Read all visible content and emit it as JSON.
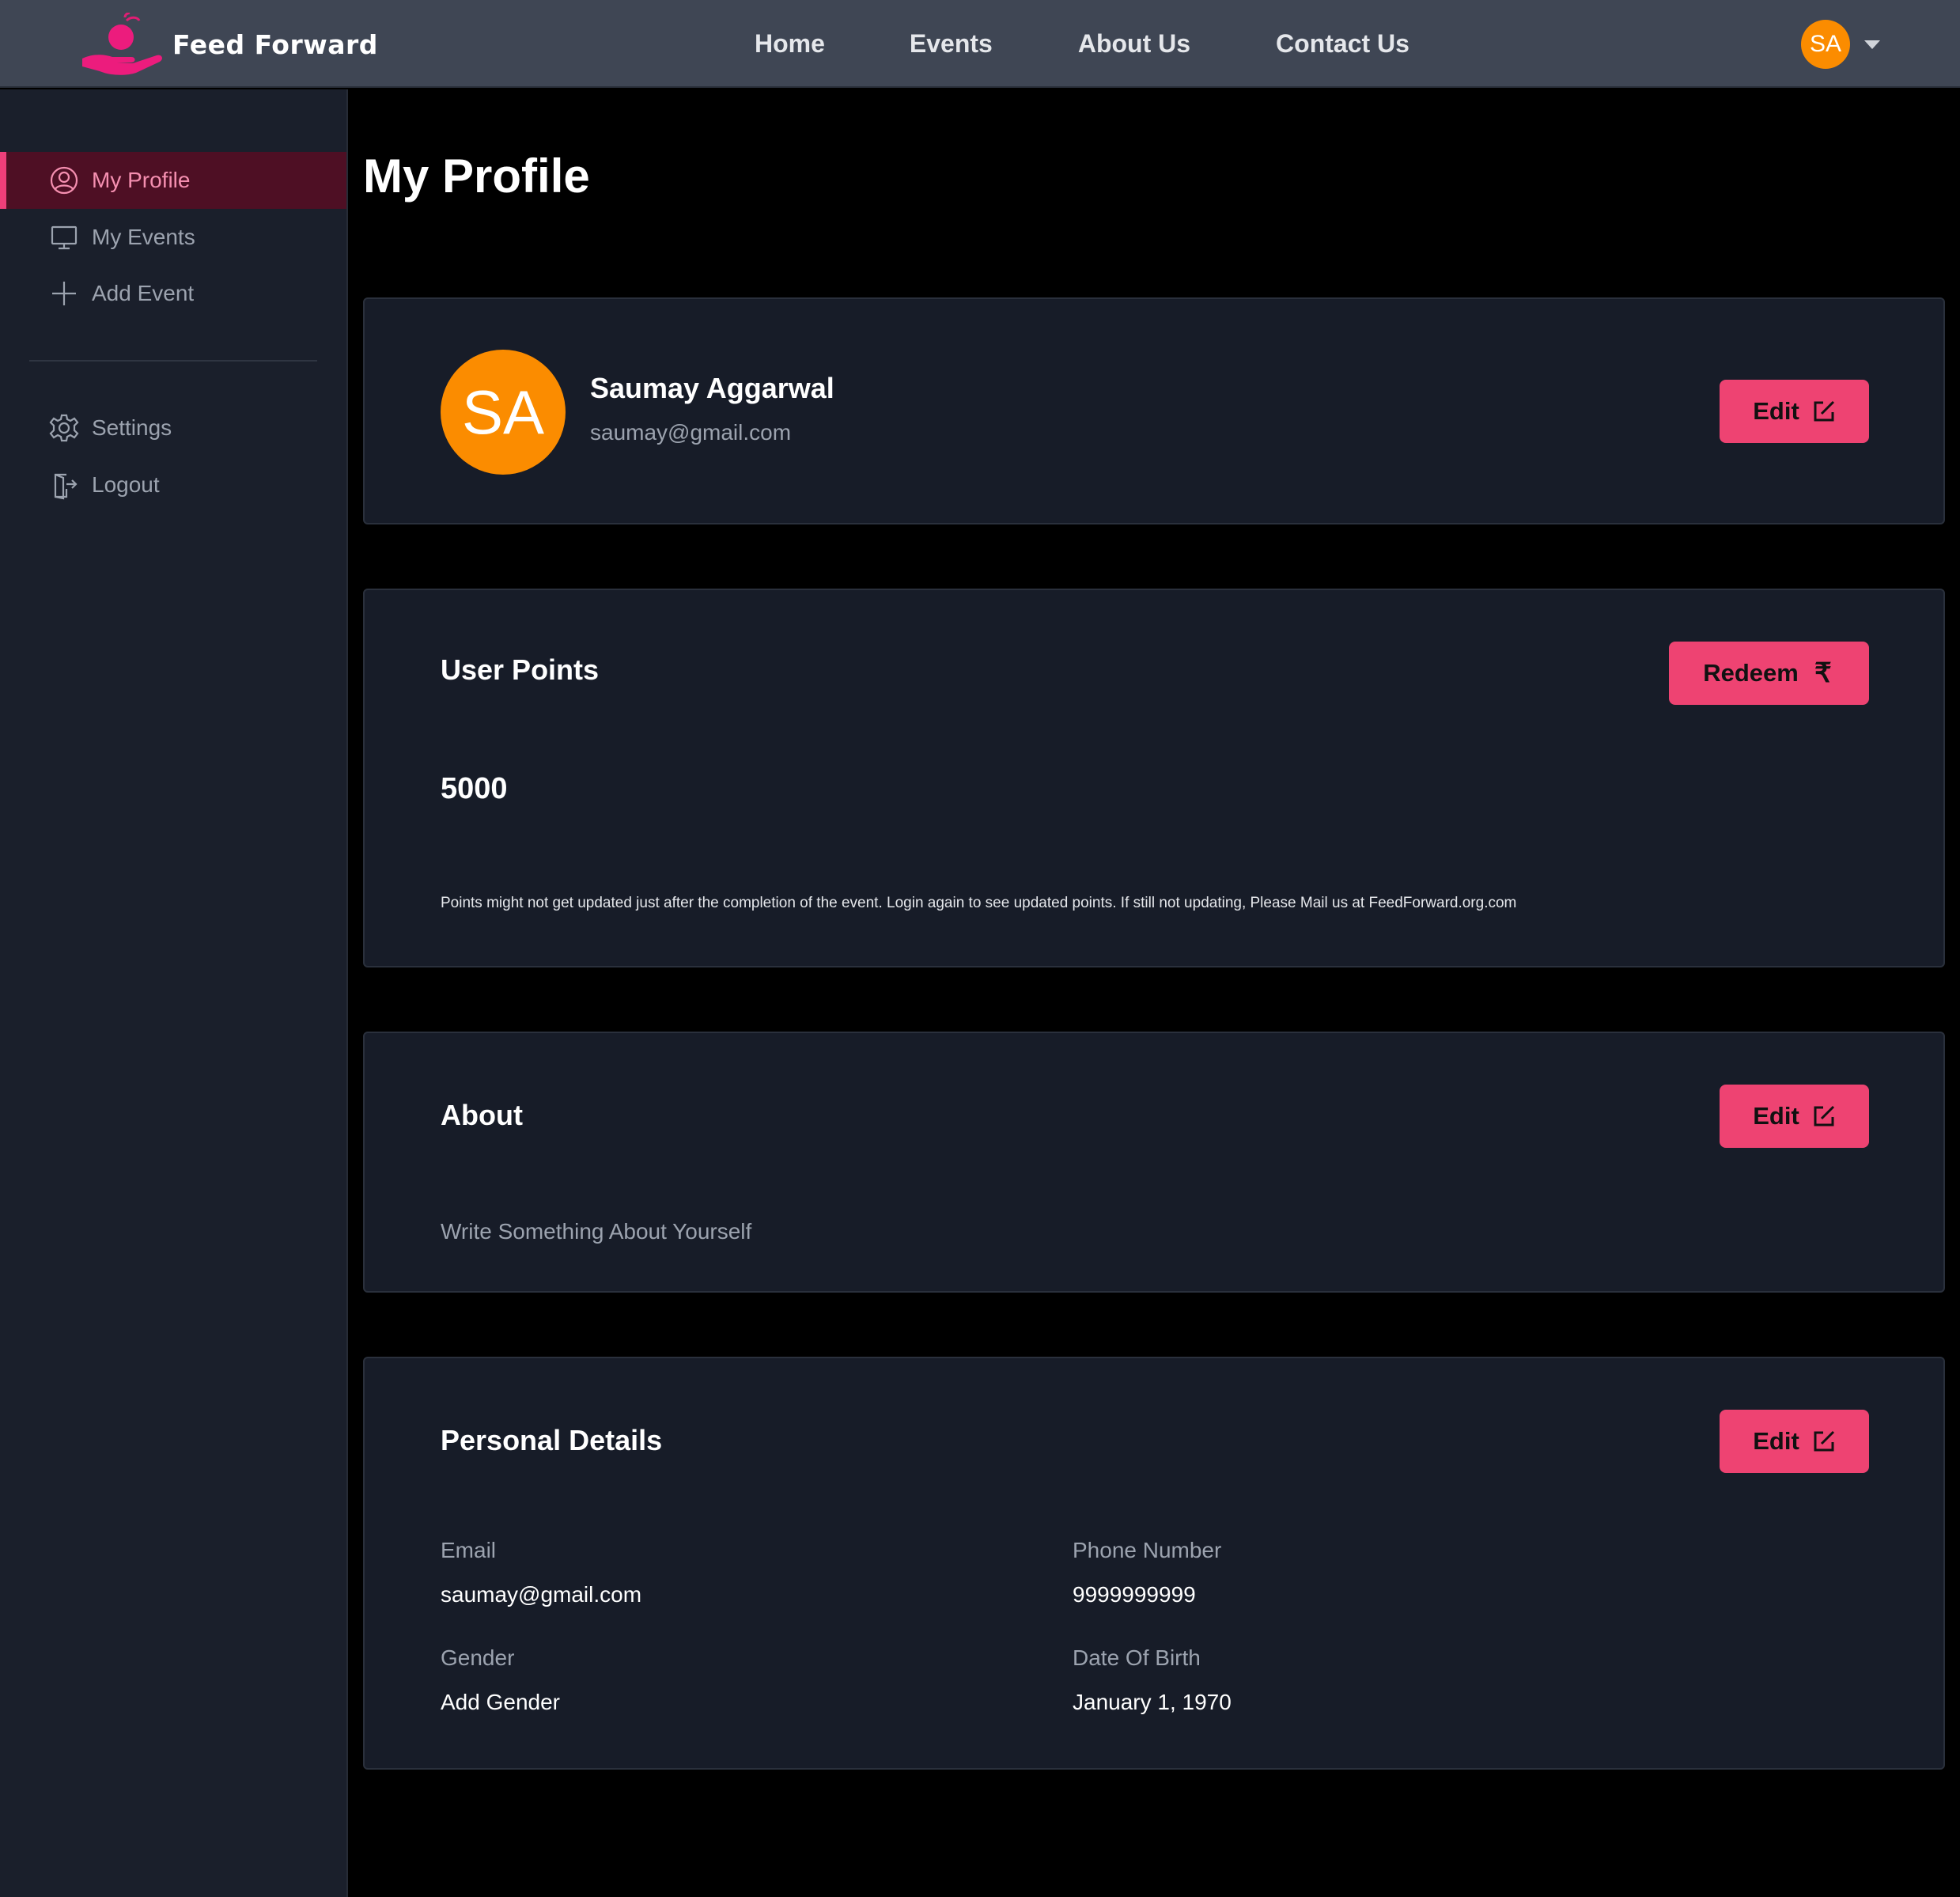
{
  "nav": {
    "brand": "Feed Forward",
    "links": [
      "Home",
      "Events",
      "About Us",
      "Contact Us"
    ],
    "user_initials": "SA"
  },
  "sidebar": {
    "items": [
      {
        "label": "My Profile",
        "icon": "user-circle-icon",
        "active": true
      },
      {
        "label": "My Events",
        "icon": "monitor-icon",
        "active": false
      },
      {
        "label": "Add Event",
        "icon": "plus-icon",
        "active": false
      },
      {
        "label": "Settings",
        "icon": "gear-icon",
        "active": false
      },
      {
        "label": "Logout",
        "icon": "logout-icon",
        "active": false
      }
    ]
  },
  "main": {
    "title": "My Profile",
    "profile": {
      "initials": "SA",
      "name": "Saumay Aggarwal",
      "email": "saumay@gmail.com",
      "edit_label": "Edit"
    },
    "points": {
      "title": "User Points",
      "redeem_label": "Redeem",
      "value": "5000",
      "note": "Points might not get updated just after the completion of the event. Login again to see updated points. If still not updating, Please Mail us at FeedForward.org.com"
    },
    "about": {
      "title": "About",
      "edit_label": "Edit",
      "text": "Write Something About Yourself"
    },
    "personal": {
      "title": "Personal Details",
      "edit_label": "Edit",
      "email_label": "Email",
      "email_value": "saumay@gmail.com",
      "phone_label": "Phone Number",
      "phone_value": "9999999999",
      "gender_label": "Gender",
      "gender_value": "Add Gender",
      "dob_label": "Date Of Birth",
      "dob_value": "January 1, 1970"
    }
  },
  "colors": {
    "accent": "#ee4372",
    "avatar": "#fb8c00",
    "nav_bg": "#3f4654",
    "sidebar_bg": "#1a1f2b",
    "card_bg": "#171c28",
    "active_item_bg": "#4e0f24"
  }
}
